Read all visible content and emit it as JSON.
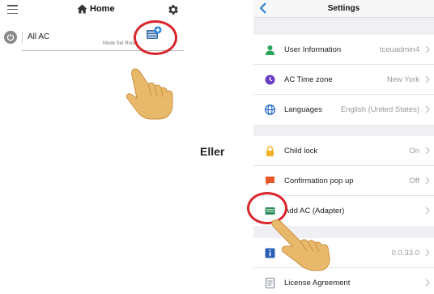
{
  "home": {
    "title": "Home",
    "group_label": "All AC",
    "mode_text": "Mode  Set  Room"
  },
  "divider_text": "Eller",
  "settings": {
    "title": "Settings",
    "groups": [
      [
        {
          "label": "User Information",
          "value": "tceuadmin4",
          "icon": "user-icon",
          "color": "#2aa35c"
        },
        {
          "label": "AC Time zone",
          "value": "New York",
          "icon": "clock-icon",
          "color": "#6a3cc4"
        },
        {
          "label": "Languages",
          "value": "English (United States)",
          "icon": "globe-icon",
          "color": "#2166c9"
        }
      ],
      [
        {
          "label": "Child lock",
          "value": "On",
          "icon": "lock-icon",
          "color": "#f1b32a"
        },
        {
          "label": "Confirmation pop up",
          "value": "Off",
          "icon": "chat-icon",
          "color": "#e8572a"
        },
        {
          "label": "Add AC (Adapter)",
          "value": "",
          "icon": "ac-unit-icon",
          "color": "#2e8c57"
        }
      ],
      [
        {
          "label": "",
          "value": "0.0.33.0",
          "icon": "info-icon",
          "color": "#2a5fb8"
        },
        {
          "label": "License Agreement",
          "value": "",
          "icon": "document-icon",
          "color": "#7a8896"
        }
      ]
    ]
  },
  "colors": {
    "annotation_red": "#d9262c",
    "hand_skin": "#e9b96b"
  }
}
